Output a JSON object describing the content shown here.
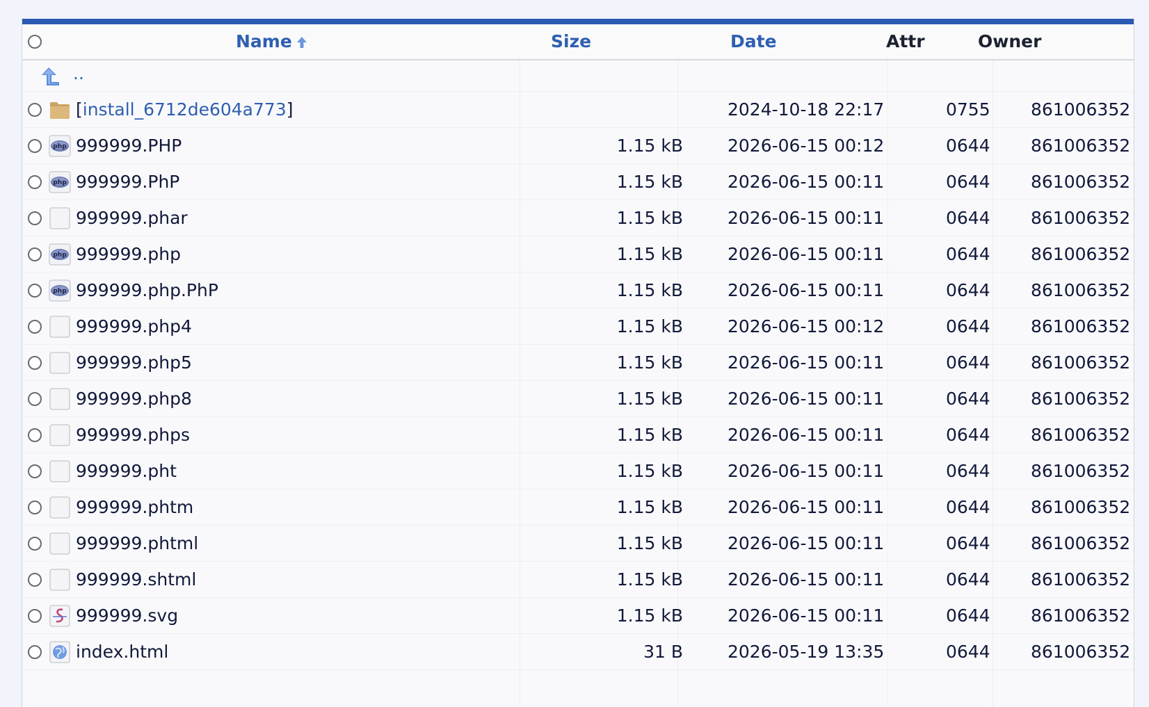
{
  "header": {
    "name": "Name",
    "size": "Size",
    "date": "Date",
    "attr": "Attr",
    "owner": "Owner"
  },
  "parent_link": "..",
  "folder": {
    "name": "install_6712de604a773",
    "open_bracket": "[",
    "close_bracket": "]",
    "date": "2024-10-18 22:17",
    "attr": "0755",
    "owner": "861006352"
  },
  "files": [
    {
      "name": "999999.PHP",
      "icon": "php-file-icon",
      "size": "1.15 kB",
      "date": "2026-06-15 00:12",
      "attr": "0644",
      "owner": "861006352"
    },
    {
      "name": "999999.PhP",
      "icon": "php-file-icon",
      "size": "1.15 kB",
      "date": "2026-06-15 00:11",
      "attr": "0644",
      "owner": "861006352"
    },
    {
      "name": "999999.phar",
      "icon": "generic-file-icon",
      "size": "1.15 kB",
      "date": "2026-06-15 00:11",
      "attr": "0644",
      "owner": "861006352"
    },
    {
      "name": "999999.php",
      "icon": "php-file-icon",
      "size": "1.15 kB",
      "date": "2026-06-15 00:11",
      "attr": "0644",
      "owner": "861006352"
    },
    {
      "name": "999999.php.PhP",
      "icon": "php-file-icon",
      "size": "1.15 kB",
      "date": "2026-06-15 00:11",
      "attr": "0644",
      "owner": "861006352"
    },
    {
      "name": "999999.php4",
      "icon": "generic-file-icon",
      "size": "1.15 kB",
      "date": "2026-06-15 00:12",
      "attr": "0644",
      "owner": "861006352"
    },
    {
      "name": "999999.php5",
      "icon": "generic-file-icon",
      "size": "1.15 kB",
      "date": "2026-06-15 00:11",
      "attr": "0644",
      "owner": "861006352"
    },
    {
      "name": "999999.php8",
      "icon": "generic-file-icon",
      "size": "1.15 kB",
      "date": "2026-06-15 00:11",
      "attr": "0644",
      "owner": "861006352"
    },
    {
      "name": "999999.phps",
      "icon": "generic-file-icon",
      "size": "1.15 kB",
      "date": "2026-06-15 00:11",
      "attr": "0644",
      "owner": "861006352"
    },
    {
      "name": "999999.pht",
      "icon": "generic-file-icon",
      "size": "1.15 kB",
      "date": "2026-06-15 00:11",
      "attr": "0644",
      "owner": "861006352"
    },
    {
      "name": "999999.phtm",
      "icon": "generic-file-icon",
      "size": "1.15 kB",
      "date": "2026-06-15 00:11",
      "attr": "0644",
      "owner": "861006352"
    },
    {
      "name": "999999.phtml",
      "icon": "generic-file-icon",
      "size": "1.15 kB",
      "date": "2026-06-15 00:11",
      "attr": "0644",
      "owner": "861006352"
    },
    {
      "name": "999999.shtml",
      "icon": "generic-file-icon",
      "size": "1.15 kB",
      "date": "2026-06-15 00:11",
      "attr": "0644",
      "owner": "861006352"
    },
    {
      "name": "999999.svg",
      "icon": "svg-file-icon",
      "size": "1.15 kB",
      "date": "2026-06-15 00:11",
      "attr": "0644",
      "owner": "861006352"
    },
    {
      "name": "index.html",
      "icon": "html-file-icon",
      "size": "31 B",
      "date": "2026-05-19 13:35",
      "attr": "0644",
      "owner": "861006352"
    }
  ],
  "colors": {
    "accent": "#2b5ab4",
    "link": "#2e5fb0",
    "text": "#11193a"
  }
}
